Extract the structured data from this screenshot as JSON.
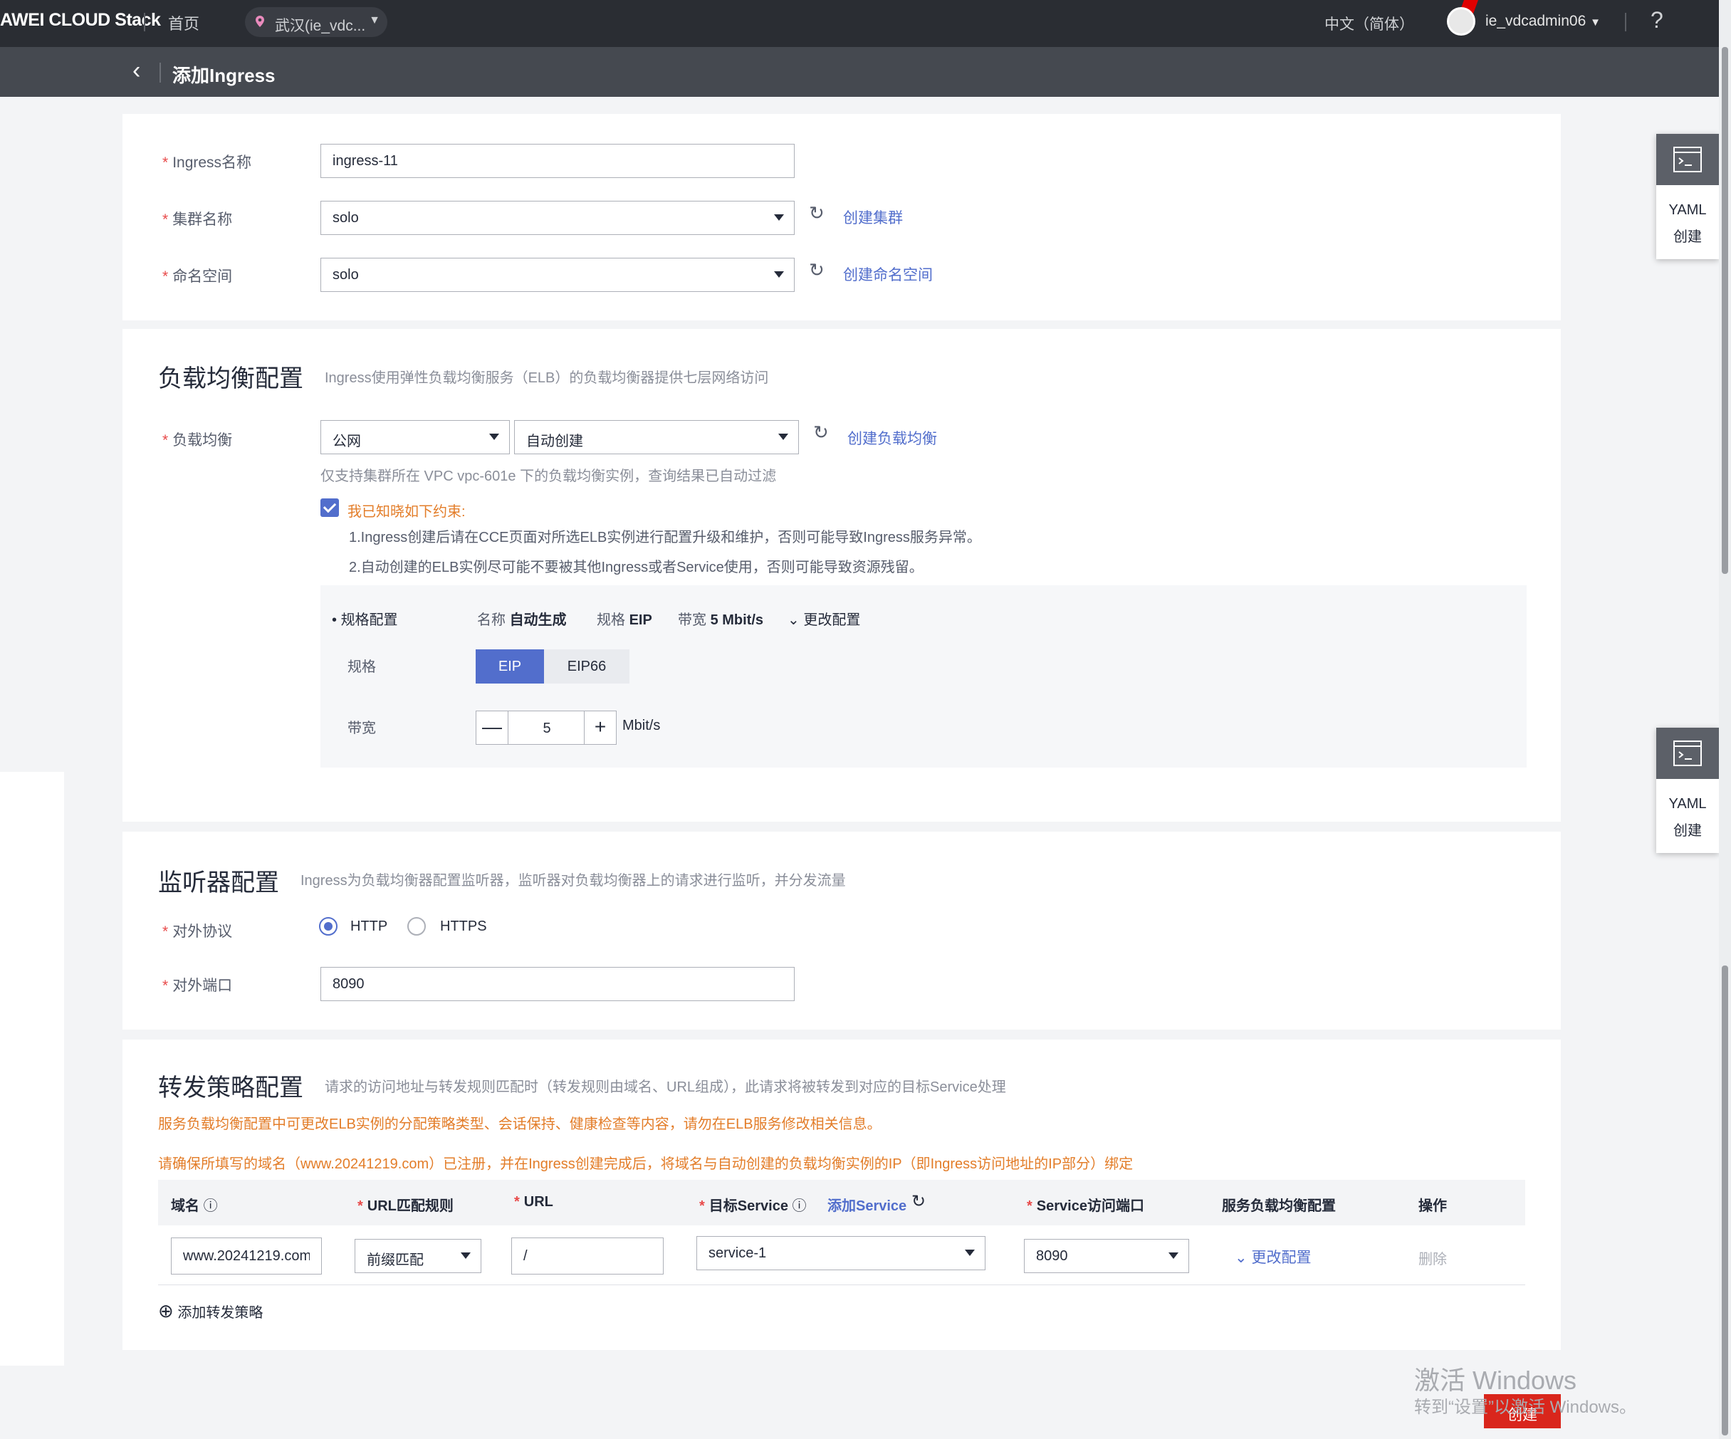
{
  "topbar": {
    "brand": "AWEI CLOUD Stack",
    "home": "首页",
    "region": "武汉(ie_vdc...",
    "language": "中文（简体）",
    "user": "ie_vdcadmin06",
    "help": "?"
  },
  "subbar": {
    "back": "‹",
    "title": "添加Ingress"
  },
  "basic": {
    "name_label": "Ingress名称",
    "name_value": "ingress-11",
    "cluster_label": "集群名称",
    "cluster_value": "solo",
    "create_cluster": "创建集群",
    "namespace_label": "命名空间",
    "namespace_value": "solo",
    "create_namespace": "创建命名空间"
  },
  "elb": {
    "title": "负载均衡配置",
    "desc": "Ingress使用弹性负载均衡服务（ELB）的负载均衡器提供七层网络访问",
    "label": "负载均衡",
    "network_value": "公网",
    "mode_value": "自动创建",
    "create_elb": "创建负载均衡",
    "hint": "仅支持集群所在 VPC vpc-601e 下的负载均衡实例，查询结果已自动过滤",
    "ack_label": "我已知晓如下约束:",
    "constraint1": "1.Ingress创建后请在CCE页面对所选ELB实例进行配置升级和维护，否则可能导致Ingress服务异常。",
    "constraint2": "2.自动创建的ELB实例尽可能不要被其他Ingress或者Service使用，否则可能导致资源残留。",
    "spec_config_label": "规格配置",
    "summary_name_k": "名称",
    "summary_name_v": "自动生成",
    "summary_spec_k": "规格",
    "summary_spec_v": "EIP",
    "summary_bw_k": "带宽",
    "summary_bw_v": "5 Mbit/s",
    "change_config": "更改配置",
    "spec_label": "规格",
    "spec_options": [
      "EIP",
      "EIP66"
    ],
    "bandwidth_label": "带宽",
    "bandwidth_value": "5",
    "bandwidth_unit": "Mbit/s",
    "minus": "—",
    "plus": "+"
  },
  "listener": {
    "title": "监听器配置",
    "desc": "Ingress为负载均衡器配置监听器，监听器对负载均衡器上的请求进行监听，并分发流量",
    "protocol_label": "对外协议",
    "protocol_http": "HTTP",
    "protocol_https": "HTTPS",
    "port_label": "对外端口",
    "port_value": "8090"
  },
  "forward": {
    "title": "转发策略配置",
    "desc": "请求的访问地址与转发规则匹配时（转发规则由域名、URL组成），此请求将被转发到对应的目标Service处理",
    "warn1": "服务负载均衡配置中可更改ELB实例的分配策略类型、会话保持、健康检查等内容，请勿在ELB服务修改相关信息。",
    "warn2": "请确保所填写的域名（www.20241219.com）已注册，并在Ingress创建完成后，将域名与自动创建的负载均衡实例的IP（即Ingress访问地址的IP部分）绑定",
    "columns": {
      "domain": "域名",
      "url_rule": "URL匹配规则",
      "url": "URL",
      "target_service": "目标Service",
      "add_service": "添加Service",
      "service_port": "Service访问端口",
      "svc_elb_config": "服务负载均衡配置",
      "action": "操作"
    },
    "row": {
      "domain": "www.20241219.com",
      "url_rule": "前缀匹配",
      "url": "/",
      "target_service": "service-1",
      "service_port": "8090",
      "change_config": "更改配置",
      "delete": "删除"
    },
    "add_policy": "添加转发策略"
  },
  "yaml_tab": {
    "line1": "YAML",
    "line2": "创建"
  },
  "footer": {
    "watermark1": "激活 Windows",
    "watermark2": "转到“设置”以激活 Windows。",
    "create": "创建"
  },
  "colors": {
    "accent": "#526ecc",
    "danger": "#d9261c",
    "warning": "#e37d29",
    "topbar": "#2a2d33"
  }
}
